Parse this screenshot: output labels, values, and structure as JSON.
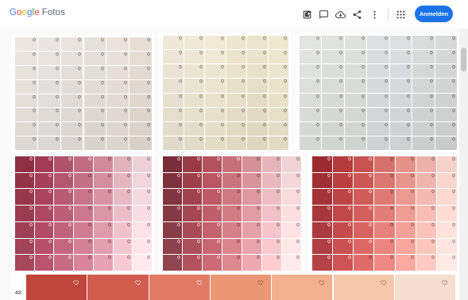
{
  "app": {
    "logo_letters": [
      "G",
      "o",
      "o",
      "g",
      "l",
      "e"
    ],
    "product": "Fotos"
  },
  "toolbar": {
    "actions": [
      {
        "name": "add-to-album-icon",
        "label": ""
      },
      {
        "name": "comment-icon",
        "label": ""
      },
      {
        "name": "cloud-download-icon",
        "label": ""
      },
      {
        "name": "share-icon",
        "label": ""
      },
      {
        "name": "more-vert-icon",
        "label": ""
      }
    ],
    "apps_icon": "apps-grid-icon",
    "signin_label": "Anmelden"
  },
  "colors": {
    "accent": "#1a73e8",
    "panel_top_left": [
      "#ece6e3",
      "#ebe5e2",
      "#e9e3e0",
      "#e7e1dc",
      "#eae3dd",
      "#e6dfd6",
      "#e9e1d7",
      "#e5ddd2"
    ],
    "panel_top_mid": [
      "#efe8d9",
      "#f0e9d6",
      "#f1ead5",
      "#eee6cf",
      "#ece4cc",
      "#f0e9d2",
      "#ede4c9",
      "#ebe2c3"
    ],
    "panel_top_right": [
      "#e2e5e1",
      "#dfe3df",
      "#dde2dd",
      "#dde0e0",
      "#dbdfdf",
      "#d8dcda",
      "#d6dad8",
      "#d3d7d6"
    ],
    "panel_bottom_left": [
      "#8f2f43",
      "#a23b55",
      "#b0526b",
      "#c06d83",
      "#cf8a9c",
      "#dfb2bc",
      "#ecd1d7"
    ],
    "panel_bottom_mid": [
      "#7a2c37",
      "#9a3a46",
      "#b4525d",
      "#c6707a",
      "#d69098",
      "#e5b5b9",
      "#f0d3d4"
    ],
    "panel_bottom_right": [
      "#9c2a2e",
      "#b53b3c",
      "#c85451",
      "#d7716b",
      "#e39189",
      "#ecb2aa",
      "#f4d1cb"
    ],
    "big_strip": [
      "#c0453a",
      "#d05d4d",
      "#e17b63",
      "#ec9774",
      "#f2b08f",
      "#f5c8ae",
      "#f5ddd0"
    ]
  },
  "big_row_number": "48"
}
